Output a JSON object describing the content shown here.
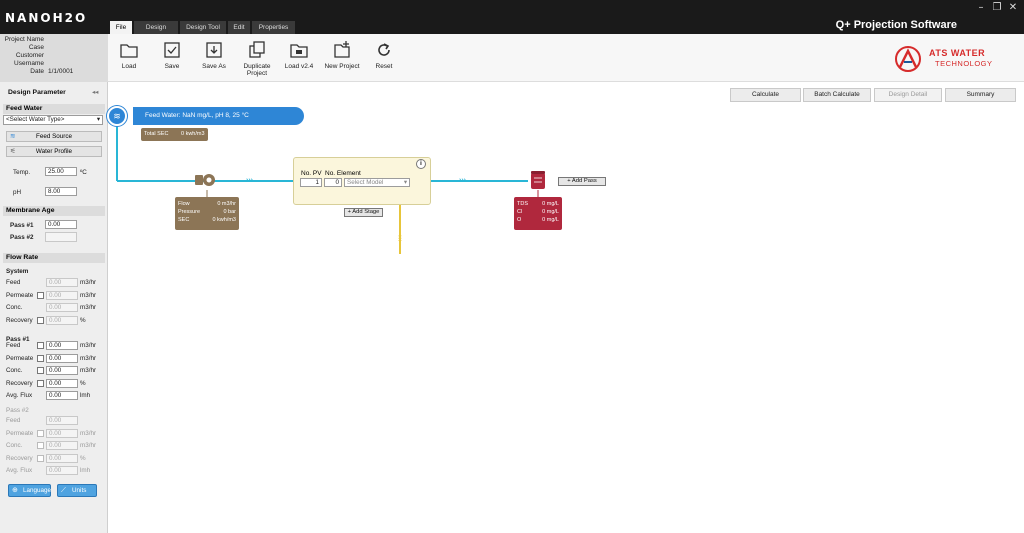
{
  "app": {
    "logo": "NANOH2O",
    "title": "Q+ Projection Software"
  },
  "window": {
    "minimize": "–",
    "restore": "❐",
    "close": "✕"
  },
  "tabs": [
    "File",
    "Design",
    "Design Tool",
    "Edit",
    "Properties"
  ],
  "project": {
    "labels": [
      "Project Name",
      "Case",
      "Customer",
      "Username",
      "Date"
    ],
    "date": "1/1/0001"
  },
  "ribbon": [
    "Load",
    "Save",
    "Save As",
    "Duplicate Project",
    "Load v2.4",
    "New Project",
    "Reset"
  ],
  "brand": {
    "line1": "ATS WATER",
    "line2": "TECHNOLOGY",
    "color": "#d62b2b"
  },
  "sidebar": {
    "header": "Design Parameter",
    "collapse": "◂◂",
    "feed_water": "Feed Water",
    "water_type": "<Select Water Type>",
    "feed_source": "Feed Source",
    "water_profile": "Water Profile",
    "temp_label": "Temp.",
    "temp_value": "25.00",
    "temp_unit": "ºC",
    "ph_label": "pH",
    "ph_value": "8.00",
    "membrane_age": "Membrane Age",
    "pass1_label": "Pass #1",
    "pass1_value": "0.00",
    "pass2_label": "Pass #2",
    "flow_rate": "Flow Rate",
    "system": "System",
    "system_rows": [
      {
        "label": "Feed",
        "value": "0.00",
        "unit": "m3/hr",
        "check": false
      },
      {
        "label": "Permeate",
        "value": "0.00",
        "unit": "m3/hr",
        "check": true
      },
      {
        "label": "Conc.",
        "value": "0.00",
        "unit": "m3/hr",
        "check": false
      },
      {
        "label": "Recovery",
        "value": "0.00",
        "unit": "%",
        "check": true
      }
    ],
    "pass1": "Pass #1",
    "pass1_rows": [
      {
        "label": "Feed",
        "value": "0.00",
        "unit": "m3/hr",
        "check": true
      },
      {
        "label": "Permeate",
        "value": "0.00",
        "unit": "m3/hr",
        "check": true
      },
      {
        "label": "Conc.",
        "value": "0.00",
        "unit": "m3/hr",
        "check": true
      },
      {
        "label": "Recovery",
        "value": "0.00",
        "unit": "%",
        "check": true
      },
      {
        "label": "Avg. Flux",
        "value": "0.00",
        "unit": "lmh",
        "check": false
      }
    ],
    "pass2": "Pass #2",
    "pass2_rows": [
      {
        "label": "Feed",
        "value": "0.00",
        "unit": "",
        "check": false
      },
      {
        "label": "Permeate",
        "value": "0.00",
        "unit": "m3/hr",
        "check": true
      },
      {
        "label": "Conc.",
        "value": "0.00",
        "unit": "m3/hr",
        "check": true
      },
      {
        "label": "Recovery",
        "value": "0.00",
        "unit": "%",
        "check": true
      },
      {
        "label": "Avg. Flux",
        "value": "0.00",
        "unit": "lmh",
        "check": false
      }
    ],
    "language": "Language",
    "units": "Units"
  },
  "toolbar": {
    "calculate": "Calculate",
    "batch": "Batch Calculate",
    "detail": "Design Detail",
    "summary": "Summary"
  },
  "diagram": {
    "feed_label": "Feed Water: NaN mg/L, pH 8, 25 °C",
    "total_sec_label": "Total SEC",
    "total_sec_value": "0 kwh/m3",
    "arrows": "›››",
    "pump": {
      "flow_label": "Flow",
      "flow_value": "0 m3/hr",
      "pressure_label": "Pressure",
      "pressure_value": "0 bar",
      "sec_label": "SEC",
      "sec_value": "0 kwh/m3"
    },
    "stage": {
      "pv_label": "No. PV",
      "element_label": "No. Element",
      "pv_value": "1",
      "element_value": "0",
      "model_placeholder": "Select Model",
      "info": "i"
    },
    "add_stage": "+ Add Stage",
    "add_pass": "+ Add Pass",
    "permeate": {
      "tds_label": "TDS",
      "tds_value": "0 mg/L",
      "cl_label": "Cl",
      "cl_value": "0 mg/L",
      "o_label": "O",
      "o_value": "0 mg/L"
    }
  },
  "colors": {
    "flow_line": "#29b6d6",
    "feed_blue": "#2e86d6",
    "brown": "#8c7556",
    "red": "#b0283d",
    "conc_line": "#e7c53a"
  }
}
